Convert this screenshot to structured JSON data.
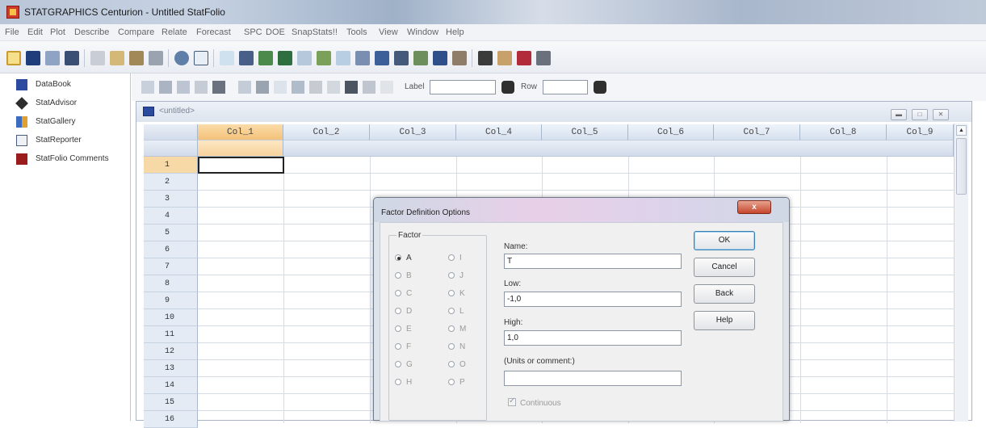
{
  "window": {
    "title": "STATGRAPHICS Centurion - Untitled StatFolio"
  },
  "menu": [
    "File",
    "Edit",
    "Plot",
    "Describe",
    "Compare",
    "Relate",
    "Forecast",
    "SPC",
    "DOE",
    "SnapStats!!",
    "Tools",
    "View",
    "Window",
    "Help"
  ],
  "sidebar": {
    "items": [
      {
        "label": "DataBook",
        "icon": "databook-icon"
      },
      {
        "label": "StatAdvisor",
        "icon": "statadvisor-icon"
      },
      {
        "label": "StatGallery",
        "icon": "statgallery-icon"
      },
      {
        "label": "StatReporter",
        "icon": "statreporter-icon"
      },
      {
        "label": "StatFolio Comments",
        "icon": "comments-icon"
      }
    ]
  },
  "toolbar2": {
    "label_text": "Label",
    "row_text": "Row"
  },
  "databook": {
    "title": "<untitled>",
    "columns": [
      "Col_1",
      "Col_2",
      "Col_3",
      "Col_4",
      "Col_5",
      "Col_6",
      "Col_7",
      "Col_8",
      "Col_9"
    ],
    "rows": [
      "1",
      "2",
      "3",
      "4",
      "5",
      "6",
      "7",
      "8",
      "9",
      "10",
      "11",
      "12",
      "13",
      "14",
      "15",
      "16"
    ]
  },
  "dialog": {
    "title": "Factor Definition Options",
    "close": "x",
    "group_label": "Factor",
    "radios_left": [
      "A",
      "B",
      "C",
      "D",
      "E",
      "F",
      "G",
      "H"
    ],
    "radios_right": [
      "I",
      "J",
      "K",
      "L",
      "M",
      "N",
      "O",
      "P"
    ],
    "name_label": "Name:",
    "name_value": "T",
    "low_label": "Low:",
    "low_value": "-1,0",
    "high_label": "High:",
    "high_value": "1,0",
    "units_label": "(Units or comment:)",
    "units_value": "",
    "continuous_label": "Continuous",
    "buttons": {
      "ok": "OK",
      "cancel": "Cancel",
      "back": "Back",
      "help": "Help"
    }
  }
}
